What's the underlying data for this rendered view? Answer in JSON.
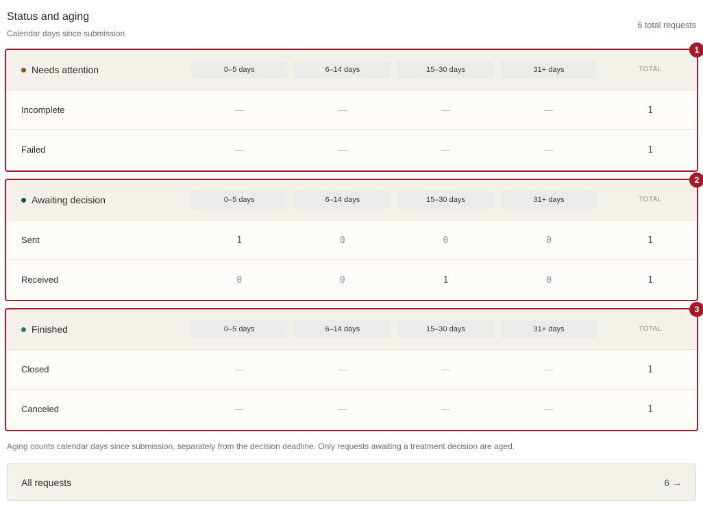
{
  "header": {
    "title": "Status and aging",
    "subtitle": "Calendar days since submission",
    "total_requests": "6 total requests"
  },
  "columns": [
    "0–5 days",
    "6–14 days",
    "15–30 days",
    "31+ days"
  ],
  "total_label": "TOTAL",
  "colors": {
    "highlight": "#a31b2a",
    "needs_attention_dot": "#8a5a1a",
    "awaiting_dot": "#1f4e4a",
    "finished_dot": "#2e7a4a",
    "number": "#2e6060"
  },
  "groups": [
    {
      "badge": "1",
      "title": "Needs attention",
      "dot_color": "#8a5a1a",
      "rows": [
        {
          "label": "Incomplete",
          "values": [
            "—",
            "—",
            "—",
            "—"
          ],
          "total": "1"
        },
        {
          "label": "Failed",
          "values": [
            "—",
            "—",
            "—",
            "—"
          ],
          "total": "1"
        }
      ]
    },
    {
      "badge": "2",
      "title": "Awaiting decision",
      "dot_color": "#1f4e4a",
      "rows": [
        {
          "label": "Sent",
          "values": [
            "1",
            "0",
            "0",
            "0"
          ],
          "total": "1"
        },
        {
          "label": "Received",
          "values": [
            "0",
            "0",
            "1",
            "0"
          ],
          "total": "1"
        }
      ]
    },
    {
      "badge": "3",
      "title": "Finished",
      "dot_color": "#2e7a4a",
      "rows": [
        {
          "label": "Closed",
          "values": [
            "—",
            "—",
            "—",
            "—"
          ],
          "total": "1"
        },
        {
          "label": "Canceled",
          "values": [
            "—",
            "—",
            "—",
            "—"
          ],
          "total": "1"
        }
      ]
    }
  ],
  "footnote": "Aging counts calendar days since submission, separately from the decision deadline. Only requests awaiting a treatment decision are aged.",
  "all_requests": {
    "label": "All requests",
    "count": "6",
    "arrow": "→"
  }
}
